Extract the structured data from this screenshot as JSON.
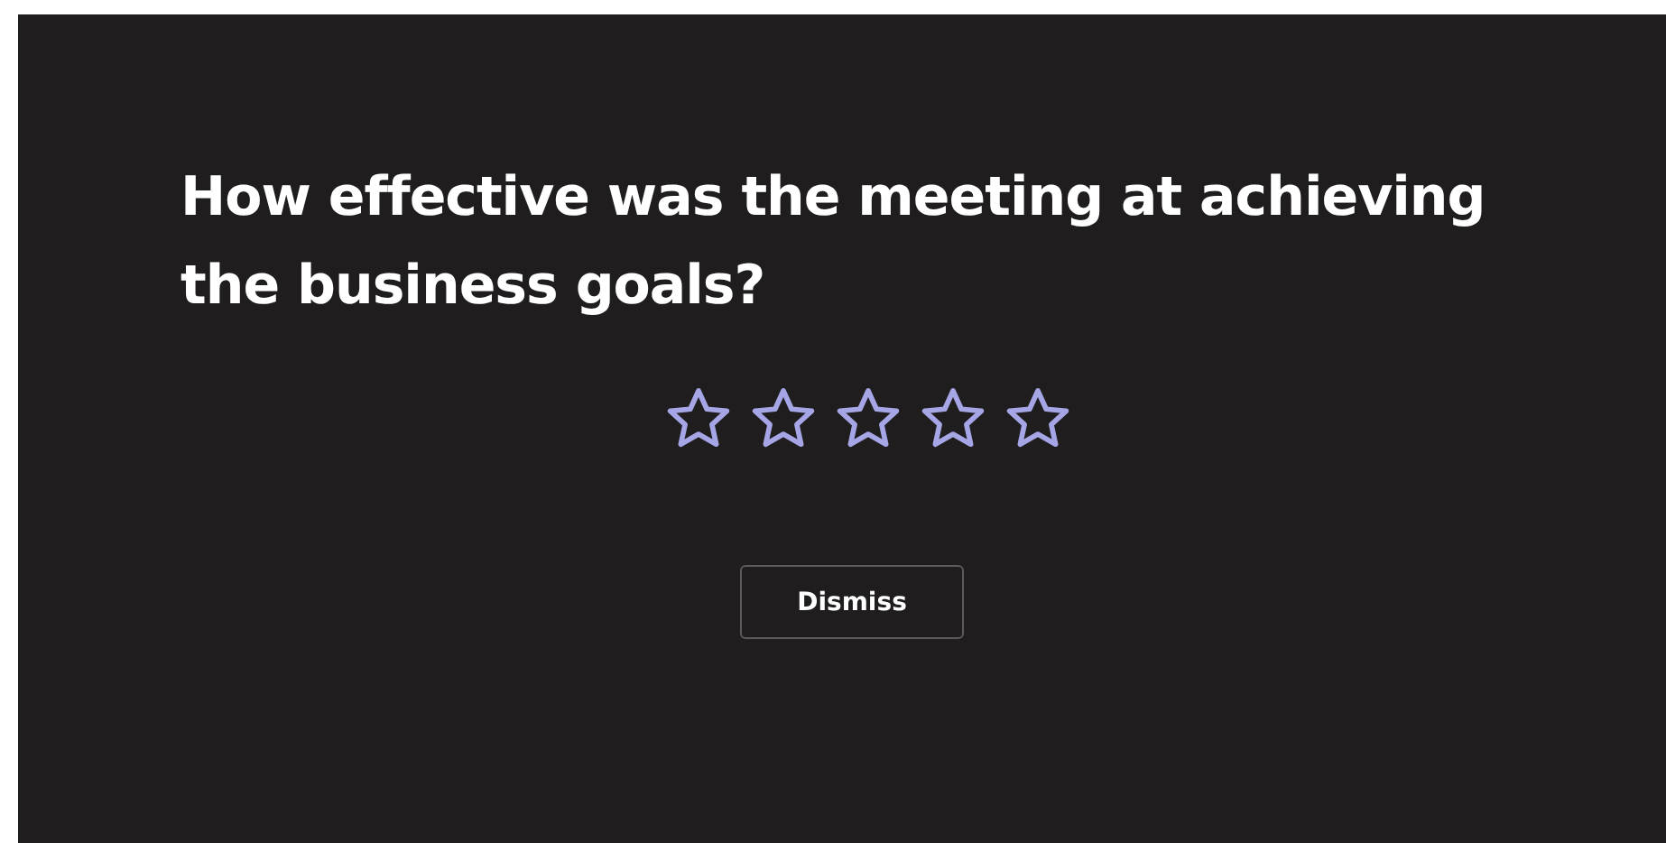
{
  "survey": {
    "question": "How effective was the meeting at achieving the business goals?",
    "rating": {
      "stars": 0
    },
    "buttons": [
      "Dismiss"
    ]
  }
}
